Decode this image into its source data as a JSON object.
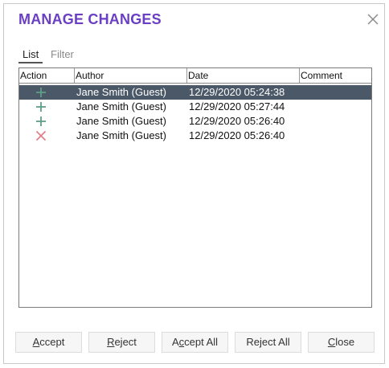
{
  "dialog": {
    "title": "MANAGE CHANGES"
  },
  "tabs": [
    {
      "label": "List",
      "active": true
    },
    {
      "label": "Filter",
      "active": false
    }
  ],
  "table": {
    "columns": [
      "Action",
      "Author",
      "Date",
      "Comment"
    ],
    "rows": [
      {
        "action_icon": "plus-icon",
        "author": "Jane Smith (Guest)",
        "date": "12/29/2020 05:24:38",
        "comment": "",
        "selected": true
      },
      {
        "action_icon": "plus-icon",
        "author": "Jane Smith (Guest)",
        "date": "12/29/2020 05:27:44",
        "comment": "",
        "selected": false
      },
      {
        "action_icon": "plus-icon",
        "author": "Jane Smith (Guest)",
        "date": "12/29/2020 05:26:40",
        "comment": "",
        "selected": false
      },
      {
        "action_icon": "cross-icon",
        "author": "Jane Smith (Guest)",
        "date": "12/29/2020 05:26:40",
        "comment": "",
        "selected": false
      }
    ]
  },
  "buttons": {
    "accept": {
      "label": "Accept",
      "mnemonic": "A"
    },
    "reject": {
      "label": "Reject",
      "mnemonic": "R"
    },
    "accept_all": {
      "label": "Accept All",
      "mnemonic": "c"
    },
    "reject_all": {
      "label": "Reject All",
      "mnemonic": "j"
    },
    "close": {
      "label": "Close",
      "mnemonic": "C"
    }
  },
  "colors": {
    "title": "#6b3fc4",
    "selected_row": "#4b5868",
    "plus_icon": "#5f9e86",
    "cross_icon": "#e07a84"
  }
}
